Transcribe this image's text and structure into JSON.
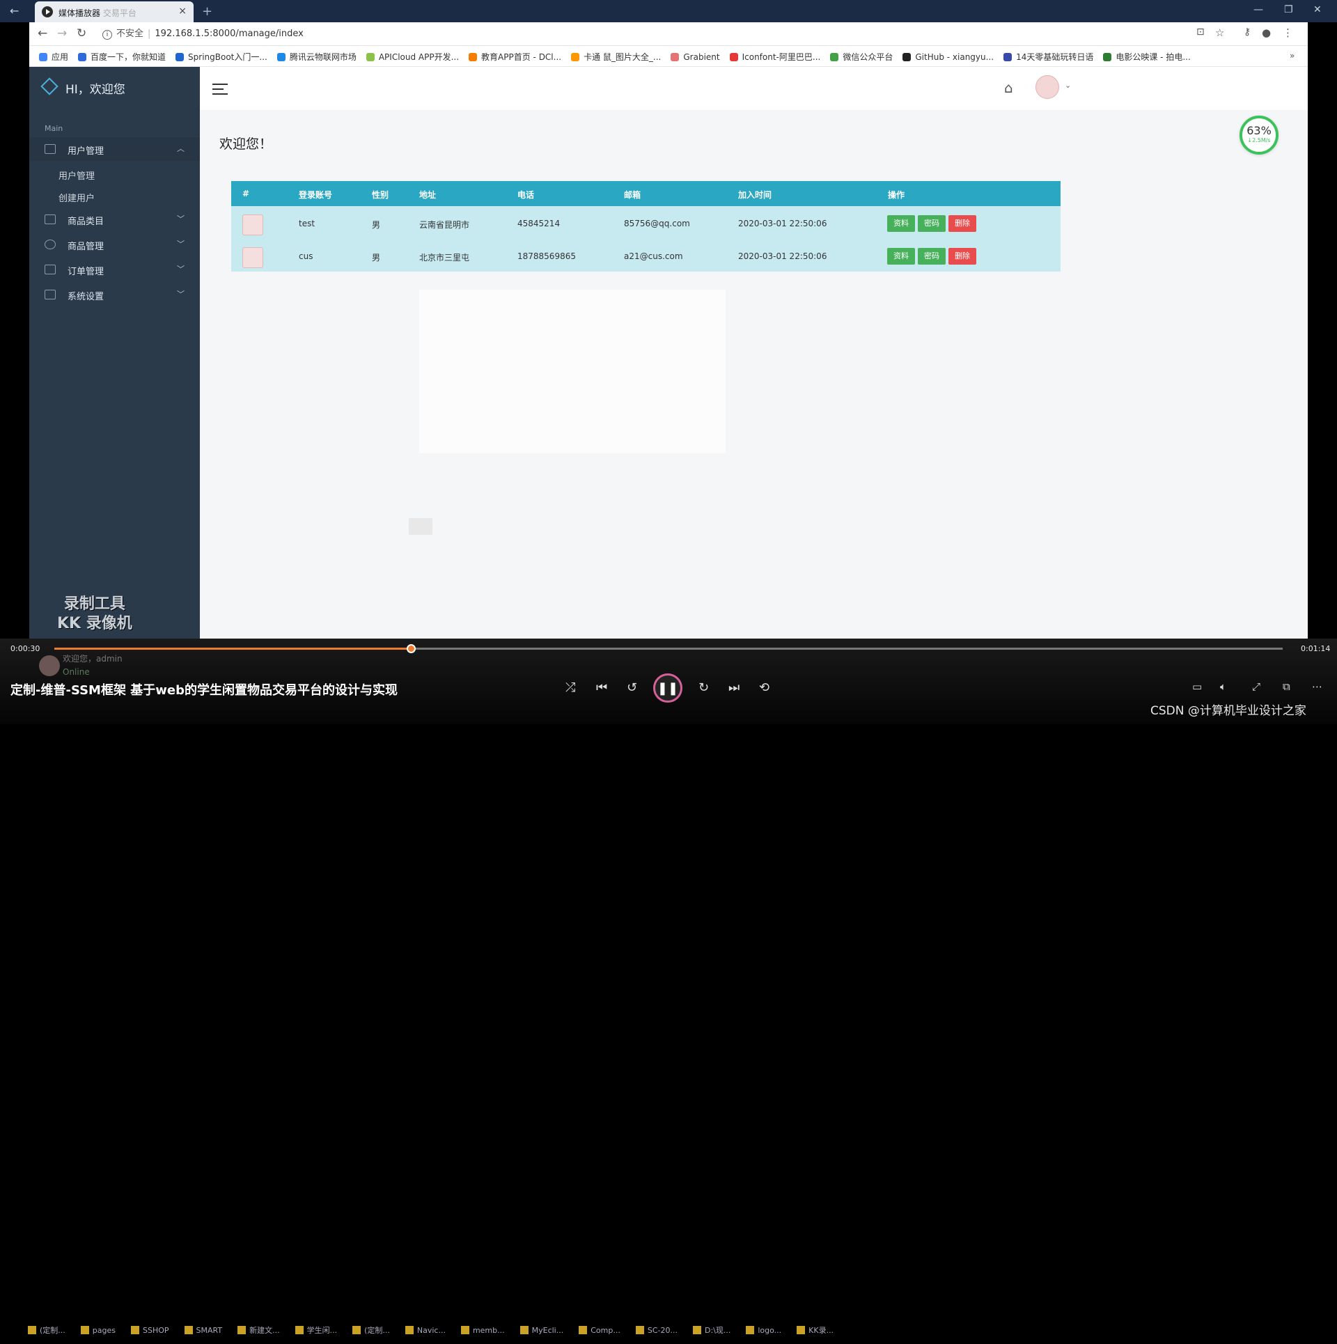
{
  "player": {
    "tab_title": "媒体播放器",
    "tab_subtitle": "交易平台",
    "new_tab": "+",
    "close": "×",
    "time_current": "0:00:30",
    "time_total": "0:01:14",
    "progress_fraction": 0.29,
    "video_title": "定制-维普-SSM框架 基于web的学生闲置物品交易平台的设计与实现",
    "ghost_user_welcome": "欢迎您，admin",
    "ghost_user_status": "Online",
    "watermark_line1": "录制工具",
    "watermark_line2": "KK 录像机",
    "credit": "CSDN @计算机毕业设计之家"
  },
  "browser": {
    "insecure": "不安全",
    "url": "192.168.1.5:8000/manage/index",
    "bookmarks": [
      {
        "label": "应用",
        "color": "#4285f4"
      },
      {
        "label": "百度一下，你就知道",
        "color": "#2f6bd8"
      },
      {
        "label": "SpringBoot入门一...",
        "color": "#2266cc"
      },
      {
        "label": "腾讯云物联网市场",
        "color": "#1e88e5"
      },
      {
        "label": "APICloud APP开发...",
        "color": "#8bc34a"
      },
      {
        "label": "教育APP首页 - DCl...",
        "color": "#f57c00"
      },
      {
        "label": "卡通 鼠_图片大全_...",
        "color": "#ff9800"
      },
      {
        "label": "Grabient",
        "color": "#e57373"
      },
      {
        "label": "Iconfont-阿里巴巴...",
        "color": "#e53935"
      },
      {
        "label": "微信公众平台",
        "color": "#43a047"
      },
      {
        "label": "GitHub - xiangyu...",
        "color": "#222222"
      },
      {
        "label": "14天零基础玩转日语",
        "color": "#3949ab"
      },
      {
        "label": "电影公映课 - 拍电...",
        "color": "#2e7d32"
      }
    ]
  },
  "sidebar": {
    "brand": "HI，欢迎您",
    "section": "Main",
    "menus": [
      {
        "label": "用户管理",
        "expanded": true,
        "sub": [
          "用户管理",
          "创建用户"
        ]
      },
      {
        "label": "商品类目",
        "expanded": false
      },
      {
        "label": "商品管理",
        "expanded": false
      },
      {
        "label": "订单管理",
        "expanded": false
      },
      {
        "label": "系统设置",
        "expanded": false
      }
    ]
  },
  "content": {
    "welcome": "欢迎您！",
    "speed_percent": "63%",
    "speed_rate": "↓2.5M/s",
    "table": {
      "headers": [
        "#",
        "登录账号",
        "性别",
        "地址",
        "电话",
        "邮箱",
        "加入时间",
        "操作"
      ],
      "rows": [
        {
          "account": "test",
          "gender": "男",
          "address": "云南省昆明市",
          "phone": "45845214",
          "email": "85756@qq.com",
          "joined": "2020-03-01 22:50:06"
        },
        {
          "account": "cus",
          "gender": "男",
          "address": "北京市三里屯",
          "phone": "18788569865",
          "email": "a21@cus.com",
          "joined": "2020-03-01 22:50:06"
        }
      ],
      "actions": {
        "info": "资料",
        "password": "密码",
        "delete": "删除"
      }
    }
  },
  "colors": {
    "sidebar": "#2b3a4b",
    "table_header": "#2aa7c2",
    "table_body": "#c7e9f0",
    "btn_green": "#47b05a",
    "btn_red": "#e84c4c",
    "progress": "#f07d2e"
  },
  "taskbar": [
    "(定制...",
    "pages",
    "SSHOP",
    "SMART",
    "新建文...",
    "学生闲...",
    "(定制...",
    "Navic...",
    "memb...",
    "MyEcli...",
    "Comp...",
    "SC-20...",
    "D:\\现...",
    "logo...",
    "KK录..."
  ]
}
